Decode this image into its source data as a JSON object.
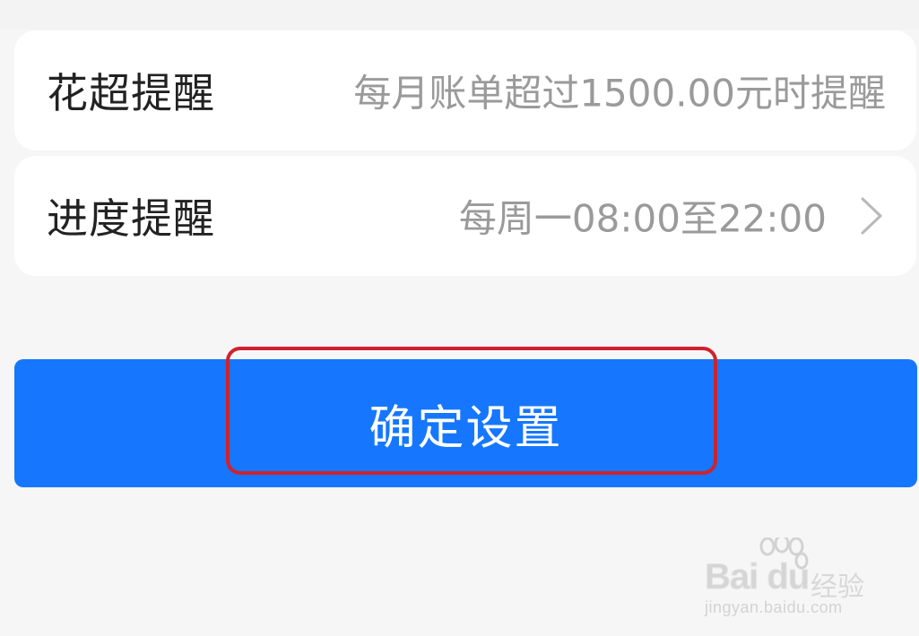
{
  "settings": {
    "rows": [
      {
        "label": "花超提醒",
        "value": "每月账单超过1500.00元时提醒"
      },
      {
        "label": "进度提醒",
        "value": "每周一08:00至22:00"
      }
    ]
  },
  "confirm": {
    "label": "确定设置"
  },
  "watermark": {
    "brand": "Bai du",
    "brand_cn": "经验",
    "url": "jingyan.baidu.com"
  },
  "colors": {
    "primary": "#1677fe",
    "highlight": "#d0222c",
    "background": "#f6f6f6",
    "card": "#ffffff"
  },
  "icons": {
    "row_chevron": "chevron-right-icon",
    "watermark": "baidu-paw-logo"
  }
}
